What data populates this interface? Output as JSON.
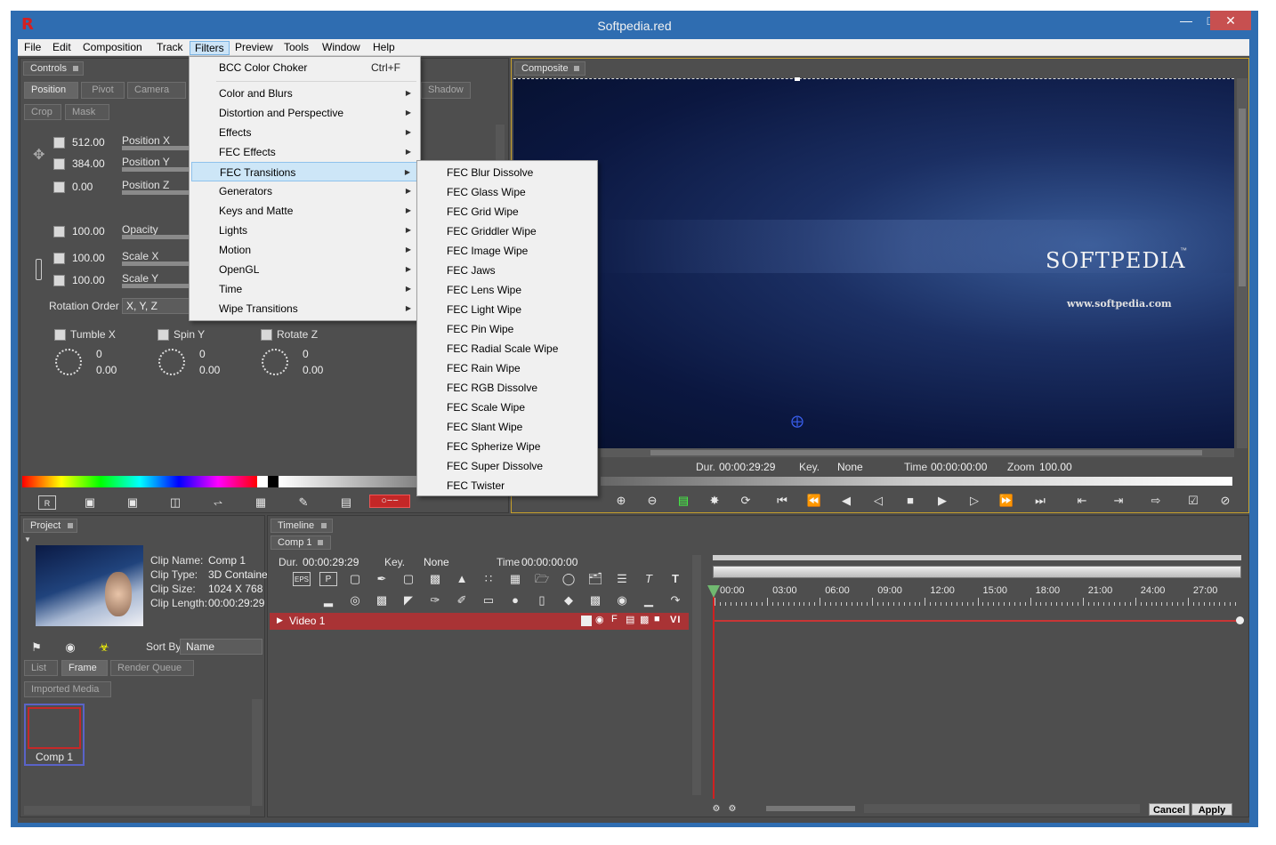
{
  "window": {
    "title": "Softpedia.red",
    "app_logo": "R",
    "controls": [
      "minimize-icon",
      "maximize-icon",
      "close-icon"
    ]
  },
  "menubar": [
    "File",
    "Edit",
    "Composition",
    "Track",
    "Filters",
    "Preview",
    "Tools",
    "Window",
    "Help"
  ],
  "filters_menu": {
    "top_item": {
      "label": "BCC Color Choker",
      "shortcut": "Ctrl+F"
    },
    "items": [
      "Color and Blurs",
      "Distortion and Perspective",
      "Effects",
      "FEC Effects",
      "FEC Transitions",
      "Generators",
      "Keys and Matte",
      "Lights",
      "Motion",
      "OpenGL",
      "Time",
      "Wipe Transitions"
    ],
    "highlighted": "FEC Transitions"
  },
  "fec_transitions_menu": [
    "FEC Blur Dissolve",
    "FEC Glass Wipe",
    "FEC Grid Wipe",
    "FEC Griddler Wipe",
    "FEC Image Wipe",
    "FEC Jaws",
    "FEC Lens Wipe",
    "FEC Light Wipe",
    "FEC Pin Wipe",
    "FEC Radial Scale Wipe",
    "FEC Rain Wipe",
    "FEC RGB Dissolve",
    "FEC Scale Wipe",
    "FEC Slant Wipe",
    "FEC Spherize Wipe",
    "FEC Super Dissolve",
    "FEC Twister"
  ],
  "controls": {
    "tab": "Controls",
    "tabs_row1": [
      "Position",
      "Pivot",
      "Camera",
      "Shadow"
    ],
    "tabs_row2": [
      "Crop",
      "Mask"
    ],
    "params": [
      {
        "label": "Position X",
        "value": "512.00"
      },
      {
        "label": "Position Y",
        "value": "384.00"
      },
      {
        "label": "Position Z",
        "value": "0.00"
      },
      {
        "label": "Opacity",
        "value": "100.00"
      },
      {
        "label": "Scale X",
        "value": "100.00"
      },
      {
        "label": "Scale Y",
        "value": "100.00"
      }
    ],
    "rotation_order_label": "Rotation Order",
    "rotation_order_value": "X, Y, Z",
    "rotations": [
      {
        "label": "Tumble X",
        "turns": "0",
        "degrees": "0.00"
      },
      {
        "label": "Spin Y",
        "turns": "0",
        "degrees": "0.00"
      },
      {
        "label": "Rotate Z",
        "turns": "0",
        "degrees": "0.00"
      }
    ]
  },
  "composite": {
    "tab": "Composite",
    "brand": "SOFTPEDIA",
    "brand_mark": "™",
    "url": "www.softpedia.com",
    "info": {
      "dur_label": "Dur.",
      "dur": "00:00:29:29",
      "key_label": "Key.",
      "key": "None",
      "time_label": "Time",
      "time": "00:00:00:00",
      "zoom_label": "Zoom",
      "zoom": "100.00"
    }
  },
  "project": {
    "tab": "Project",
    "clip": {
      "name_label": "Clip Name:",
      "name": "Comp 1",
      "type_label": "Clip Type:",
      "type": "3D Container",
      "size_label": "Clip Size:",
      "size": "1024 X 768",
      "length_label": "Clip Length:",
      "length": "00:00:29:29"
    },
    "sort_by_label": "Sort By",
    "sort_by": "Name",
    "tabs": [
      "List",
      "Frame",
      "Render Queue"
    ],
    "folder_tab": "Imported Media",
    "item": "Comp 1"
  },
  "timeline": {
    "tab": "Timeline",
    "comp_tab": "Comp 1",
    "dur_label": "Dur.",
    "dur": "00:00:29:29",
    "key_label": "Key.",
    "key": "None",
    "time_label": "Time",
    "time": "00:00:00:00",
    "ruler": [
      "00:00",
      "03:00",
      "06:00",
      "09:00",
      "12:00",
      "15:00",
      "18:00",
      "21:00",
      "24:00",
      "27:00"
    ],
    "track": "Video 1",
    "track_flags": "V I",
    "eps_label": "EPS",
    "p_label": "P"
  },
  "buttons": {
    "cancel": "Cancel",
    "apply": "Apply"
  },
  "colors": {
    "titlebar": "#2f6db1",
    "panel": "#4e4e4e",
    "menu_bg": "#f0f0f0",
    "menu_highlight": "#cde6f7",
    "track": "#a93335",
    "playhead": "#d02020"
  }
}
